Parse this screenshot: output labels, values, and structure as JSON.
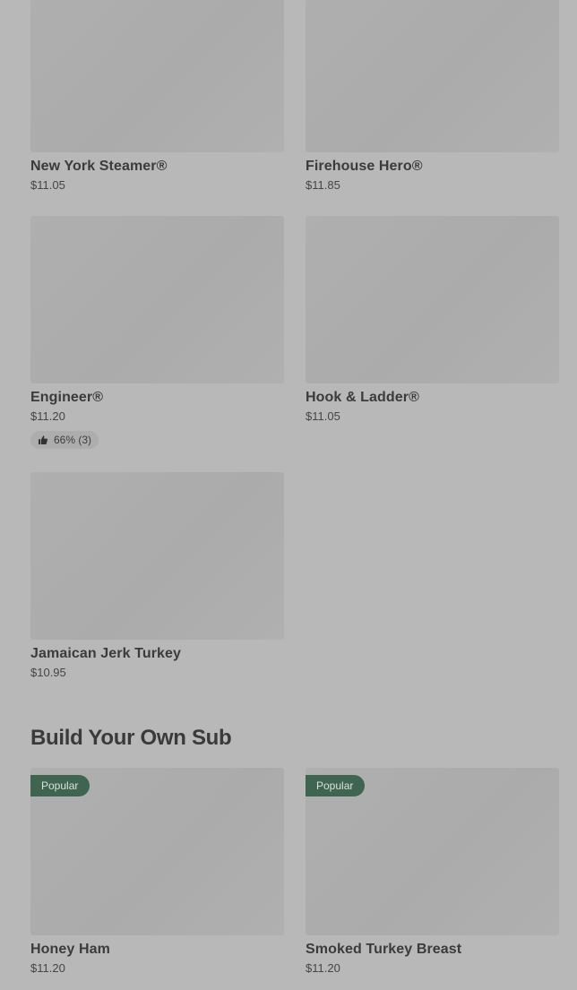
{
  "items": [
    {
      "name": "New York Steamer®",
      "price": "$11.05"
    },
    {
      "name": "Firehouse Hero®",
      "price": "$11.85"
    },
    {
      "name": "Engineer®",
      "price": "$11.20",
      "rating": "66% (3)"
    },
    {
      "name": "Hook & Ladder®",
      "price": "$11.05"
    },
    {
      "name": "Jamaican Jerk Turkey",
      "price": "$10.95"
    }
  ],
  "build_your_own": {
    "title": "Build Your Own Sub",
    "items": [
      {
        "name": "Honey Ham",
        "price": "$11.20",
        "badge": "Popular"
      },
      {
        "name": "Smoked Turkey Breast",
        "price": "$11.20",
        "badge": "Popular"
      }
    ]
  },
  "icons": {
    "rating": "thumbs-up-icon"
  }
}
